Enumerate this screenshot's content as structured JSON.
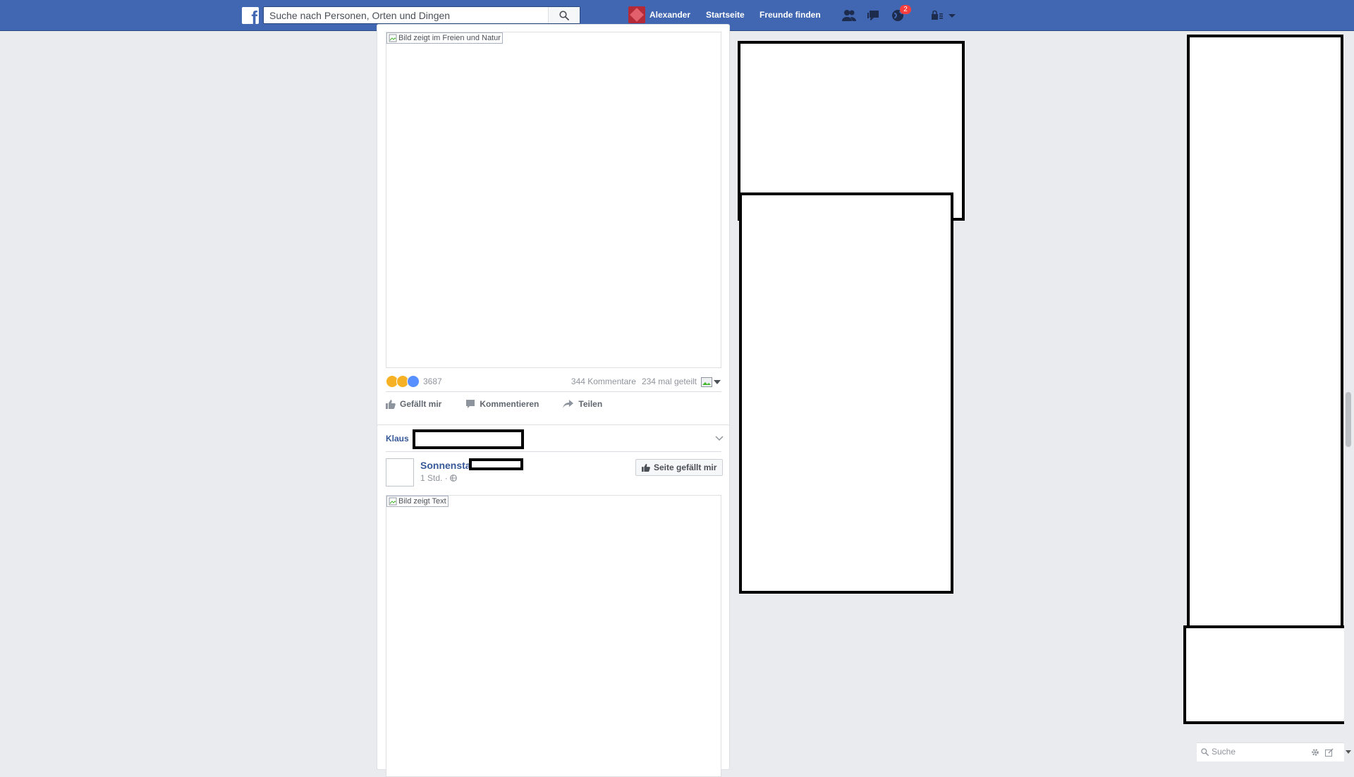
{
  "header": {
    "search_placeholder": "Suche nach Personen, Orten und Dingen",
    "user_name": "Alexander",
    "home_label": "Startseite",
    "find_friends_label": "Freunde finden",
    "notifications_badge": "2"
  },
  "feed": {
    "post1": {
      "image_alt": "Bild zeigt im Freien und Natur",
      "reactions_count": "3687",
      "comments": "344 Kommentare",
      "shares": "234 mal geteilt",
      "reactions": [
        "sad-icon",
        "wow-icon",
        "like-icon"
      ],
      "actions": {
        "like": "Gefällt mir",
        "comment": "Kommentieren",
        "share": "Teilen"
      }
    },
    "post2": {
      "friend_name": "Klaus",
      "page_name": "Sonnensta",
      "time": "1 Std. ·",
      "like_page_label": "Seite gefällt mir",
      "image_alt": "Bild zeigt Text"
    }
  },
  "chat": {
    "search_placeholder": "Suche"
  },
  "colors": {
    "brand": "#4267b2",
    "link": "#365899",
    "background": "#e9ebee",
    "badge": "#fa3e3e"
  }
}
